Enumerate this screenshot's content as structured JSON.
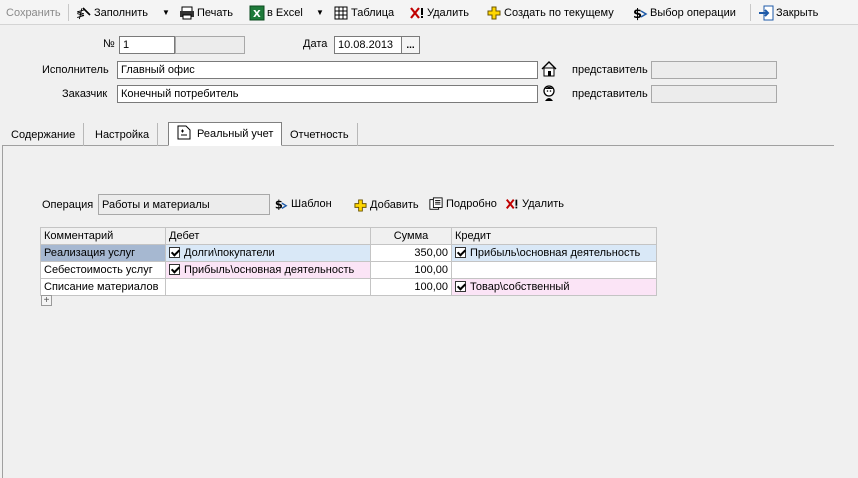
{
  "toolbar": {
    "save": "Сохранить",
    "fill": "Заполнить",
    "print": "Печать",
    "excel": "в Excel",
    "table": "Таблица",
    "delete": "Удалить",
    "create_from_current": "Создать по текущему",
    "select_operation": "Выбор операции",
    "close": "Закрыть"
  },
  "header": {
    "number_label": "№",
    "number_value": "1",
    "date_label": "Дата",
    "date_value": "10.08.2013",
    "executor_label": "Исполнитель",
    "executor_value": "Главный офис",
    "customer_label": "Заказчик",
    "customer_value": "Конечный потребитель",
    "representative_label": "представитель",
    "date_button": "..."
  },
  "tabs": [
    {
      "label": "Содержание"
    },
    {
      "label": "Настройка"
    },
    {
      "label": "Реальный учет"
    },
    {
      "label": "Отчетность"
    }
  ],
  "operation": {
    "label": "Операция",
    "value": "Работы и материалы",
    "template": "Шаблон",
    "add": "Добавить",
    "details": "Подробно",
    "delete": "Удалить"
  },
  "grid": {
    "columns": [
      "Комментарий",
      "Дебет",
      "Сумма",
      "Кредит"
    ],
    "rows": [
      {
        "comment": "Реализация услуг",
        "debit": "Долги\\покупатели",
        "debit_checked": true,
        "sum": "350,00",
        "credit": "Прибыль\\основная деятельность",
        "credit_checked": true
      },
      {
        "comment": "Себестоимость услуг",
        "debit": "Прибыль\\основная деятельность",
        "debit_checked": true,
        "sum": "100,00",
        "credit": "",
        "credit_checked": false
      },
      {
        "comment": "Списание материалов",
        "debit": "",
        "debit_checked": false,
        "sum": "100,00",
        "credit": "Товар\\собственный",
        "credit_checked": true
      }
    ],
    "add_row": "+"
  },
  "colors": {
    "selected_cell": "#a6b8d1",
    "debit_highlight": "#d9e8f7",
    "pink_highlight": "#fbe4f6"
  }
}
